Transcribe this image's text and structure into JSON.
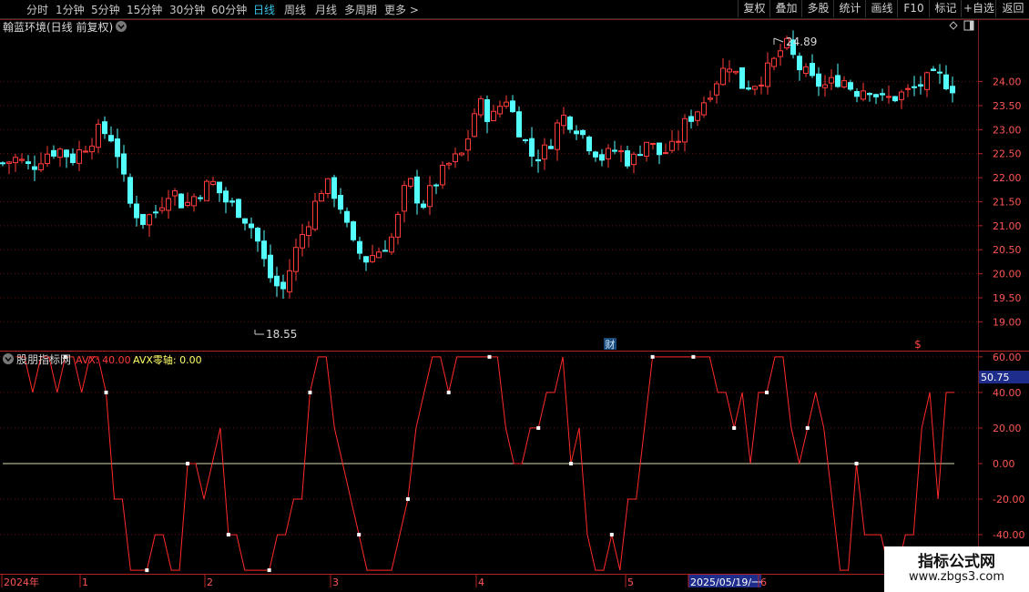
{
  "toolbar": {
    "periods": [
      "分时",
      "1分钟",
      "5分钟",
      "15分钟",
      "30分钟",
      "60分钟",
      "日线",
      "周线",
      "月线",
      "多周期",
      "更多 >"
    ],
    "active_period": "日线",
    "right_buttons": [
      "复权",
      "叠加",
      "多股",
      "统计",
      "画线",
      "F10",
      "标记",
      "+自选",
      "返回"
    ]
  },
  "main_panel": {
    "title": "翰蓝环境(日线 前复权)",
    "high_label": "24.89",
    "low_label": "18.55",
    "y_ticks": [
      "24.00",
      "23.50",
      "23.00",
      "22.50",
      "22.00",
      "21.50",
      "21.00",
      "20.50",
      "20.00",
      "19.50",
      "19.00"
    ],
    "markers": {
      "finance": "财",
      "dividend": "$"
    },
    "up_color": "#ff3b3b",
    "down_color": "#54ffff"
  },
  "indicator_panel": {
    "name": "股朋指标网",
    "avx_label": "AVX: 40.00",
    "zero_label": "AVX零轴: 0.00",
    "current_value": "50.75",
    "y_ticks": [
      "60.00",
      "40.00",
      "20.00",
      "0.00",
      "-20.00",
      "-40.00"
    ]
  },
  "time_axis": {
    "labels": [
      "2024年",
      "1",
      "2",
      "3",
      "4",
      "5",
      "2025/05/19/一",
      "6"
    ]
  },
  "watermark": {
    "line1": "指标公式网",
    "line2": "www.zbgs3.com"
  },
  "chart_data": [
    {
      "type": "candlestick",
      "title": "翰蓝环境(日线 前复权)",
      "ylim": [
        18.4,
        25.3
      ],
      "y_ticks": [
        19.0,
        19.5,
        20.0,
        20.5,
        21.0,
        21.5,
        22.0,
        22.5,
        23.0,
        23.5,
        24.0
      ],
      "annotations": [
        {
          "text": "24.89",
          "kind": "high"
        },
        {
          "text": "18.55",
          "kind": "low"
        }
      ],
      "x_month_labels": [
        "2024年",
        "1",
        "2",
        "3",
        "4",
        "5",
        "6"
      ],
      "approx_close_path": [
        22.3,
        22.4,
        22.2,
        22.5,
        22.6,
        22.4,
        22.7,
        23.0,
        22.8,
        21.5,
        21.1,
        21.3,
        21.8,
        21.4,
        21.7,
        21.9,
        21.5,
        21.3,
        20.9,
        20.0,
        19.6,
        20.5,
        21.2,
        21.9,
        21.6,
        20.6,
        20.3,
        20.5,
        20.8,
        22.0,
        21.4,
        21.9,
        22.3,
        22.5,
        23.6,
        23.2,
        23.7,
        23.0,
        22.4,
        22.6,
        23.3,
        23.1,
        22.7,
        22.4,
        22.6,
        22.3,
        22.8,
        22.5,
        22.6,
        23.2,
        23.5,
        24.0,
        24.4,
        23.9,
        24.0,
        24.3,
        24.8,
        24.3,
        24.0,
        23.9,
        24.1,
        23.8,
        23.9,
        23.6,
        23.7,
        23.8,
        24.0,
        24.1,
        23.9
      ]
    },
    {
      "type": "line",
      "title": "股朋指标网",
      "series": [
        {
          "name": "AVX",
          "values": [
            60,
            60,
            40,
            60,
            60,
            40,
            60,
            60,
            40,
            60,
            60,
            40,
            -20,
            -20,
            -60,
            -60,
            -60,
            -40,
            -40,
            -60,
            -60,
            0,
            0,
            -20,
            0,
            20,
            -40,
            -40,
            -60,
            -60,
            -60,
            -60,
            -40,
            -40,
            -20,
            -20,
            40,
            60,
            60,
            20,
            0,
            -20,
            -40,
            -60,
            -60,
            -60,
            -60,
            -40,
            -20,
            20,
            40,
            60,
            60,
            40,
            60,
            60,
            60,
            60,
            60,
            60,
            20,
            0,
            0,
            20,
            20,
            40,
            40,
            60,
            0,
            20,
            -40,
            -60,
            -60,
            -40,
            -60,
            -20,
            -20,
            20,
            60,
            60,
            60,
            60,
            60,
            60,
            60,
            60,
            40,
            40,
            20,
            40,
            0,
            40,
            40,
            60,
            60,
            20,
            0,
            20,
            40,
            20,
            -20,
            -60,
            -60,
            0,
            -40,
            -40,
            -40,
            -60,
            -60,
            -40,
            -40,
            20,
            40,
            -20,
            40,
            40
          ]
        }
      ],
      "zero_line": 0,
      "ylim": [
        -62,
        63
      ],
      "y_ticks": [
        60,
        40,
        20,
        0,
        -20,
        -40
      ]
    }
  ]
}
